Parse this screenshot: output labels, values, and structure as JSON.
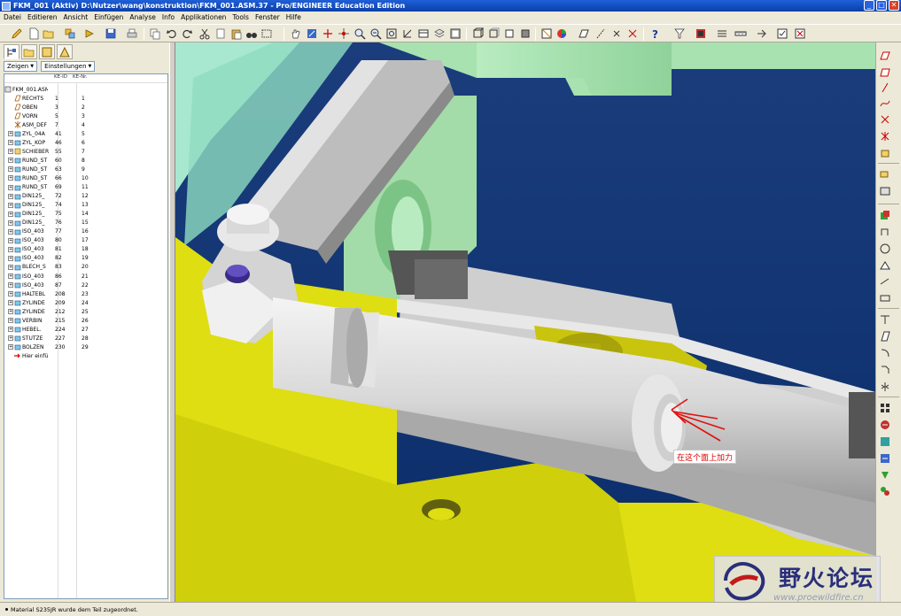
{
  "window": {
    "title": "FKM_001 (Aktiv) D:\\Nutzer\\wang\\konstruktion\\FKM_001.ASM.37 - Pro/ENGINEER Education Edition",
    "buttons": {
      "minimize": "_",
      "maximize": "□",
      "close": "✕"
    }
  },
  "menu": [
    "Datei",
    "Editieren",
    "Ansicht",
    "Einfügen",
    "Analyse",
    "Info",
    "Applikationen",
    "Tools",
    "Fenster",
    "Hilfe"
  ],
  "model_tree": {
    "show_button": "Zeigen",
    "settings_button": "Einstellungen",
    "columns": {
      "id": "KE-ID",
      "nr": "KE-Nr."
    },
    "root": "FKM_001.ASM",
    "items": [
      {
        "label": "RECHTS",
        "id": "1",
        "nr": "1",
        "icon": "datum-plane-icon",
        "expandable": false
      },
      {
        "label": "OBEN",
        "id": "3",
        "nr": "2",
        "icon": "datum-plane-icon",
        "expandable": false
      },
      {
        "label": "VORN",
        "id": "5",
        "nr": "3",
        "icon": "datum-plane-icon",
        "expandable": false
      },
      {
        "label": "ASM_DEF",
        "id": "7",
        "nr": "4",
        "icon": "coordinate-system-icon",
        "expandable": false
      },
      {
        "label": "ZYL_04A",
        "id": "41",
        "nr": "5",
        "icon": "part-icon",
        "expandable": true
      },
      {
        "label": "ZYL_KOP",
        "id": "46",
        "nr": "6",
        "icon": "part-icon",
        "expandable": true
      },
      {
        "label": "SCHIEBER",
        "id": "55",
        "nr": "7",
        "icon": "subassembly-icon",
        "expandable": true
      },
      {
        "label": "RUND_ST",
        "id": "60",
        "nr": "8",
        "icon": "part-icon",
        "expandable": true
      },
      {
        "label": "RUND_ST",
        "id": "63",
        "nr": "9",
        "icon": "part-icon",
        "expandable": true
      },
      {
        "label": "RUND_ST",
        "id": "66",
        "nr": "10",
        "icon": "part-icon",
        "expandable": true
      },
      {
        "label": "RUND_ST",
        "id": "69",
        "nr": "11",
        "icon": "part-icon",
        "expandable": true
      },
      {
        "label": "DIN125_",
        "id": "72",
        "nr": "12",
        "icon": "part-icon",
        "expandable": true
      },
      {
        "label": "DIN125_",
        "id": "74",
        "nr": "13",
        "icon": "part-icon",
        "expandable": true
      },
      {
        "label": "DIN125_",
        "id": "75",
        "nr": "14",
        "icon": "part-icon",
        "expandable": true
      },
      {
        "label": "DIN125_",
        "id": "76",
        "nr": "15",
        "icon": "part-icon",
        "expandable": true
      },
      {
        "label": "ISO_403",
        "id": "77",
        "nr": "16",
        "icon": "part-icon",
        "expandable": true
      },
      {
        "label": "ISO_403",
        "id": "80",
        "nr": "17",
        "icon": "part-icon",
        "expandable": true
      },
      {
        "label": "ISO_403",
        "id": "81",
        "nr": "18",
        "icon": "part-icon",
        "expandable": true
      },
      {
        "label": "ISO_403",
        "id": "82",
        "nr": "19",
        "icon": "part-icon",
        "expandable": true
      },
      {
        "label": "BLECH_S",
        "id": "83",
        "nr": "20",
        "icon": "part-icon",
        "expandable": true
      },
      {
        "label": "ISO_403",
        "id": "86",
        "nr": "21",
        "icon": "part-icon",
        "expandable": true
      },
      {
        "label": "ISO_403",
        "id": "87",
        "nr": "22",
        "icon": "part-icon",
        "expandable": true
      },
      {
        "label": "HALTEBL",
        "id": "208",
        "nr": "23",
        "icon": "part-icon",
        "expandable": true
      },
      {
        "label": "ZYLINDE",
        "id": "209",
        "nr": "24",
        "icon": "part-icon",
        "expandable": true
      },
      {
        "label": "ZYLINDE",
        "id": "212",
        "nr": "25",
        "icon": "part-icon",
        "expandable": true
      },
      {
        "label": "VERBIN",
        "id": "215",
        "nr": "26",
        "icon": "part-icon",
        "expandable": true
      },
      {
        "label": "HEBEL.",
        "id": "224",
        "nr": "27",
        "icon": "part-icon",
        "expandable": true
      },
      {
        "label": "STUTZE",
        "id": "227",
        "nr": "28",
        "icon": "part-icon",
        "expandable": true
      },
      {
        "label": "BOLZEN",
        "id": "230",
        "nr": "29",
        "icon": "part-icon",
        "expandable": true
      },
      {
        "label": "Hier einfü",
        "id": "",
        "nr": "",
        "icon": "insert-here-arrow-icon",
        "expandable": false
      }
    ]
  },
  "viewport": {
    "annotation": "在这个面上加力",
    "annotation_color": "#dd0000",
    "colors": {
      "background_top": "#1d3f7a",
      "background_bottom": "#0a2e6b",
      "yellow_part": "#e0e010",
      "green_part": "#98d6a0",
      "gray_part": "#cfcfcf"
    }
  },
  "watermark": {
    "brand": "野火论坛",
    "url": "www.proewildfire.cn"
  },
  "status": {
    "message": "Material S235JR wurde dem Teil zugeordnet."
  }
}
